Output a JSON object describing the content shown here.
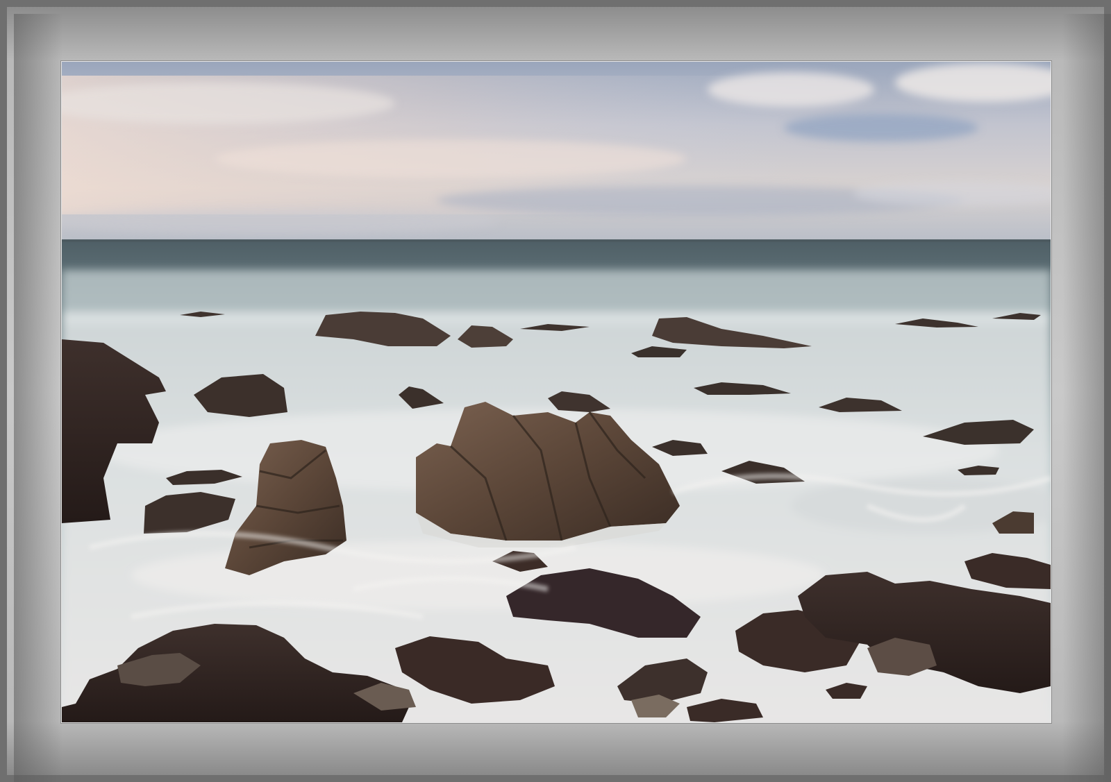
{
  "image": {
    "subject": "seascape",
    "colors": {
      "frame": "#bdbdbd",
      "sky_top": "#8f9db4",
      "sky_warm": "#e6d3c8",
      "sea_dark": "#5f6f74",
      "surf": "#e4e6e6",
      "rock": "#4a3a30"
    }
  }
}
